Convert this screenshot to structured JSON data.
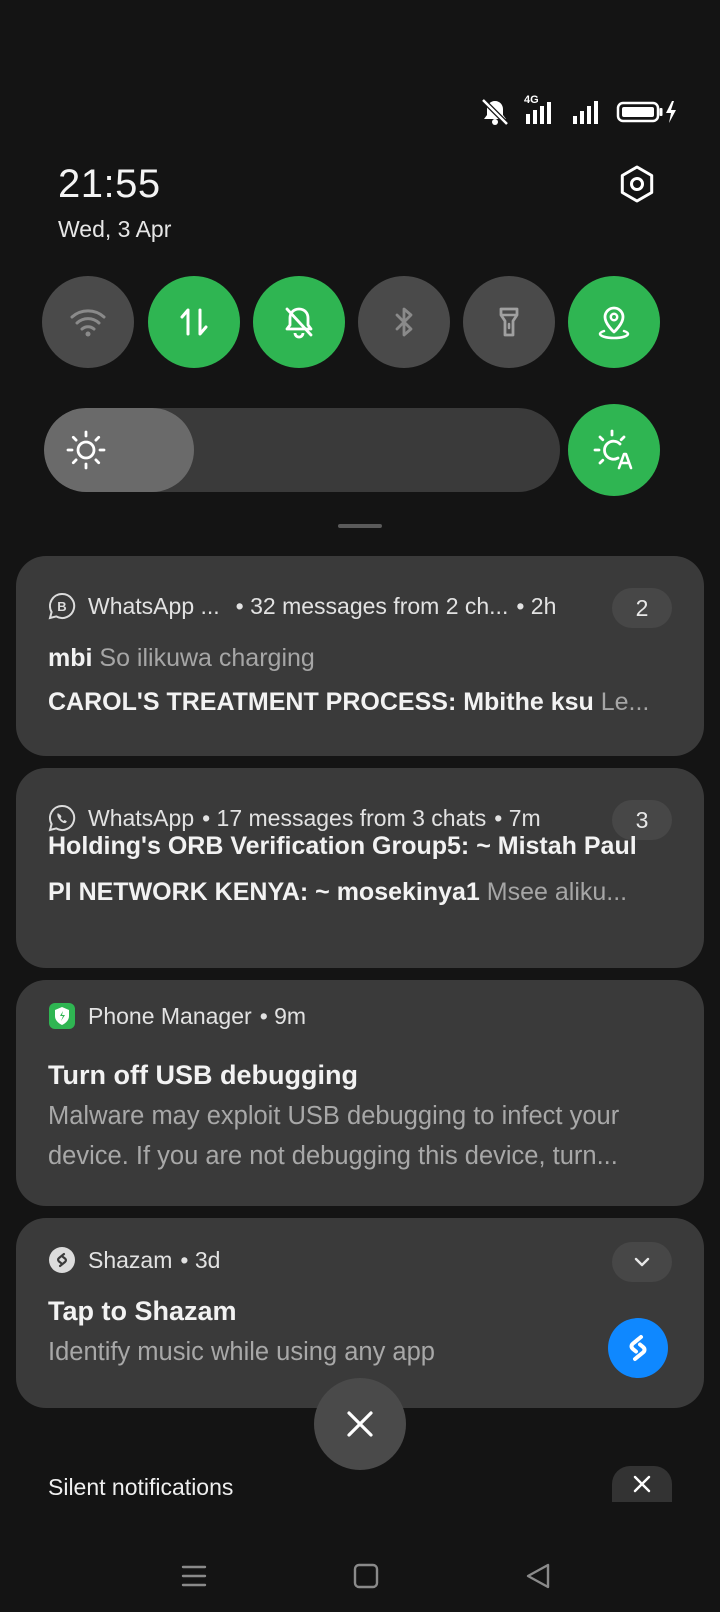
{
  "status_bar": {
    "network_label": "4G"
  },
  "header": {
    "time": "21:55",
    "date": "Wed, 3 Apr"
  },
  "quick_tiles": [
    {
      "name": "wifi",
      "state": "off"
    },
    {
      "name": "mobile-data",
      "state": "on"
    },
    {
      "name": "silent-mode",
      "state": "on"
    },
    {
      "name": "bluetooth",
      "state": "off"
    },
    {
      "name": "flashlight",
      "state": "off"
    },
    {
      "name": "location",
      "state": "on"
    }
  ],
  "brightness": {
    "level": 0.29,
    "auto": true
  },
  "notifications": {
    "whatsapp_business": {
      "app": "WhatsApp ...",
      "summary": "• 32 messages from 2 ch...",
      "time": "• 2h",
      "count": "2",
      "row1_sender": "mbi",
      "row1_text": "So ilikuwa charging",
      "row2_sender": "CAROL'S TREATMENT PROCESS: Mbithe ksu",
      "row2_text": "Le..."
    },
    "whatsapp": {
      "app": "WhatsApp",
      "summary": "• 17 messages from 3 chats",
      "time": "• 7m",
      "count": "3",
      "row1_sender": "Holding's ORB Verification Group5: ~ Mistah Paul",
      "row2_sender": "PI NETWORK KENYA: ~ mosekinya1",
      "row2_text": "Msee aliku..."
    },
    "phone_manager": {
      "app": "Phone Manager",
      "time": "• 9m",
      "title": "Turn off USB debugging",
      "body_line1": "Malware may exploit USB debugging to infect your",
      "body_line2": "device. If you are not debugging this device, turn..."
    },
    "shazam": {
      "app": "Shazam",
      "time": "• 3d",
      "title": "Tap to Shazam",
      "body": "Identify music while using any app"
    }
  },
  "silent_section": {
    "label": "Silent notifications"
  },
  "colors": {
    "accent_green": "#2fb552",
    "shazam_blue": "#0f88ff",
    "card_bg": "#3a3a3a"
  }
}
